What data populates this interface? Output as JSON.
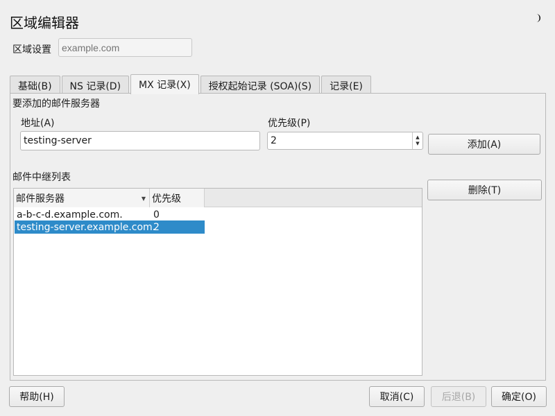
{
  "window": {
    "title": "区域编辑器",
    "mode_icon": "moon-icon"
  },
  "zone": {
    "label": "区域设置",
    "placeholder": "example.com"
  },
  "tabs": [
    {
      "label": "基础(B)",
      "active": false
    },
    {
      "label": "NS 记录(D)",
      "active": false
    },
    {
      "label": "MX 记录(X)",
      "active": true
    },
    {
      "label": "授权起始记录 (SOA)(S)",
      "active": false
    },
    {
      "label": "记录(E)",
      "active": false
    }
  ],
  "mx": {
    "section_label": "要添加的邮件服务器",
    "address_label": "地址(A)",
    "address_value": "testing-server",
    "priority_label": "优先级(P)",
    "priority_value": "2",
    "add_button": "添加(A)",
    "delete_button": "删除(T)",
    "list_label": "邮件中继列表",
    "columns": [
      "邮件服务器",
      "优先级"
    ],
    "rows": [
      {
        "server": "a-b-c-d.example.com.",
        "priority": "0"
      },
      {
        "server": "testing-server.example.com.",
        "priority": "2"
      }
    ]
  },
  "footer": {
    "help": "帮助(H)",
    "cancel": "取消(C)",
    "back": "后退(B)",
    "ok": "确定(O)"
  }
}
